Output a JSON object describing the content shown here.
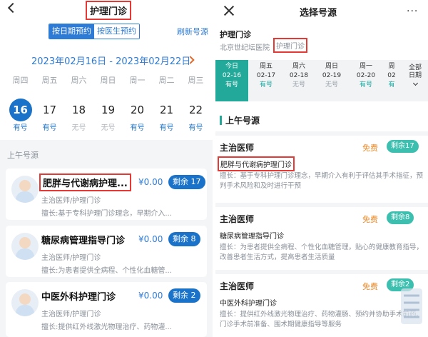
{
  "left": {
    "title": "护理门诊",
    "tabs": {
      "by_date": "按日期预约",
      "by_doctor": "按医生预约"
    },
    "refresh_label": "刷新号源",
    "date_range": "2023年02月16日 - 2023年02月22日",
    "weekdays": [
      "周四",
      "周五",
      "周六",
      "周日",
      "周一",
      "周二",
      "周三"
    ],
    "days": [
      {
        "num": "16",
        "status": "有号",
        "selected": true
      },
      {
        "num": "17",
        "status": "有号"
      },
      {
        "num": "18",
        "status": "无号"
      },
      {
        "num": "19",
        "status": "无号"
      },
      {
        "num": "20",
        "status": "有号"
      },
      {
        "num": "21",
        "status": "有号"
      },
      {
        "num": "22",
        "status": "有号"
      }
    ],
    "section_label": "上午号源",
    "cards": [
      {
        "name": "肥胖与代谢病护理...",
        "price": "¥0.00",
        "remain": "剩余 17",
        "role": "主治医师/护理门诊",
        "desc": "擅长:基于专科护理门诊理念，早期介入..."
      },
      {
        "name": "糖尿病管理指导门诊",
        "price": "¥0.00",
        "remain": "剩余 8",
        "role": "主治医师/护理门诊",
        "desc": "擅长:为患者提供全病程、个性化血糖管..."
      },
      {
        "name": "中医外科护理门诊",
        "price": "¥0.00",
        "remain": "剩余 2",
        "role": "主治医师/护理门诊",
        "desc": "擅长:提供红外线激光物理治疗、药物灌..."
      }
    ]
  },
  "right": {
    "title": "选择号源",
    "more": "···",
    "clinic_name": "护理门诊",
    "hospital": "北京世纪坛医院",
    "dept": "护理门诊",
    "dates": [
      {
        "a": "今日",
        "b": "02-16",
        "s": "有号",
        "selected": true
      },
      {
        "a": "周五",
        "b": "02-17",
        "s": "有号"
      },
      {
        "a": "周六",
        "b": "02-18",
        "s": "无号"
      },
      {
        "a": "周日",
        "b": "02-19",
        "s": "无号"
      },
      {
        "a": "周一",
        "b": "02-20",
        "s": "有号"
      },
      {
        "a": "周",
        "b": "02",
        "s": "有"
      }
    ],
    "all_dates": {
      "line1": "全部",
      "line2": "日期"
    },
    "section_label": "上午号源",
    "cards": [
      {
        "doctor": "主治医师",
        "free": "免费",
        "remain": "剩余17",
        "clinic": "肥胖与代谢病护理门诊",
        "desc": "擅长：基于专科护理门诊理念，早期介入有利于评估其手术指征，预判手术风险和及时进行干预"
      },
      {
        "doctor": "主治医师",
        "free": "免费",
        "remain": "剩余8",
        "clinic": "糖尿病管理指导门诊",
        "desc": "擅长：为患者提供全病程、个性化血糖管理，贴心的健康教育指导，改善患者生活方式，提高患者生活质量"
      },
      {
        "doctor": "主治医师",
        "free": "免费",
        "remain": "剩余2",
        "clinic": "中医外科护理门诊",
        "desc": "擅长：提供红外线激光物理治疗、药物灌肠、预约并协助手术前药、门诊手术前准备、围术期健康指导等服务"
      }
    ]
  },
  "colors": {
    "blue": "#1a73c9",
    "teal": "#23a99a",
    "orange": "#e8892b",
    "highlight_red": "#e53935"
  }
}
